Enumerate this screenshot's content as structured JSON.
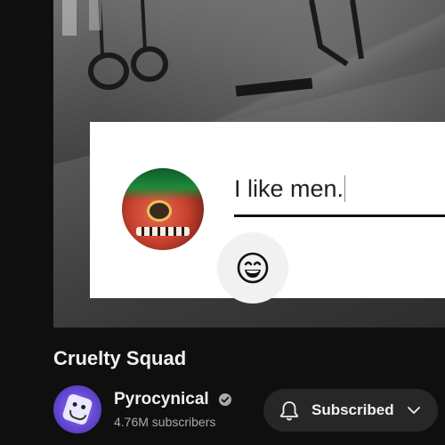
{
  "video": {
    "comment_text": "I like men."
  },
  "video_title": "Cruelty Squad",
  "channel": {
    "name": "Pyrocynical",
    "subscribers": "4.76M subscribers",
    "subscribe_label": "Subscribed"
  },
  "icons": {
    "emoji": "smiley-face-icon",
    "verified": "verified-check-icon",
    "bell": "bell-icon",
    "chevron": "chevron-down-icon"
  },
  "colors": {
    "background": "#0f0f0f",
    "button_bg": "#272727",
    "text_primary": "#f1f1f1",
    "text_secondary": "#aaaaaa"
  }
}
